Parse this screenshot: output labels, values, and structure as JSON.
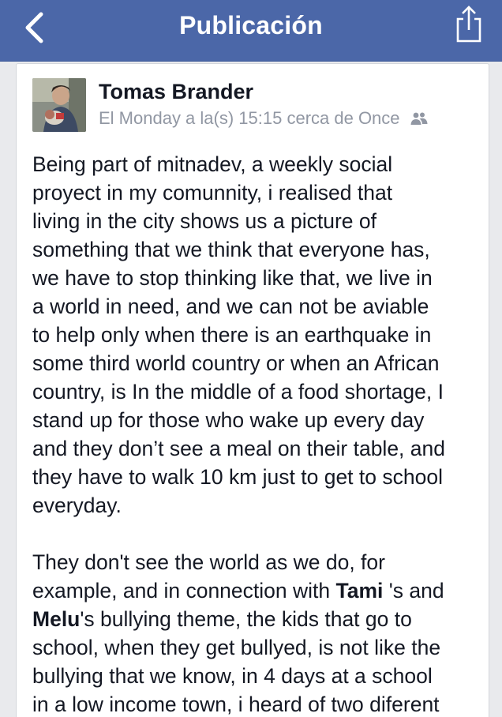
{
  "header": {
    "title": "Publicación",
    "back_icon": "chevron-left-icon",
    "share_icon": "share-icon",
    "bg_color": "#4b67a8"
  },
  "post": {
    "author": "Tomas Brander",
    "meta": "El Monday a la(s) 15:15 cerca de Once",
    "audience_icon": "friends-icon",
    "paragraph1": [
      "Being part of mitnadev, a weekly social",
      "proyect in my comunnity, i realised that",
      "living in the city shows us a picture of",
      "something that we think that everyone has,",
      "we have to stop thinking like that, we live in",
      "a world in need, and we can not be aviable",
      "to help only when there is an earthquake in",
      "some third world country or when an African",
      "country, is In the middle of a food shortage, I",
      "stand up for those who wake up every day",
      "and they don’t see a meal on their table, and",
      "they have to walk 10 km just to get to school",
      "everyday."
    ],
    "paragraph2": {
      "line1": "They don't see the world as we do, for",
      "line2_before": "example, and in connection with ",
      "tag1": "Tami",
      "line2_after": " 's and",
      "tag2": "Melu",
      "line3_after": "'s bullying theme, the kids that go to",
      "line4": "school, when they get bullyed, is not like the",
      "line5": "bullying that we know, in 4 days at a school",
      "line6": "in a low income town, i heard of two diferent"
    }
  }
}
